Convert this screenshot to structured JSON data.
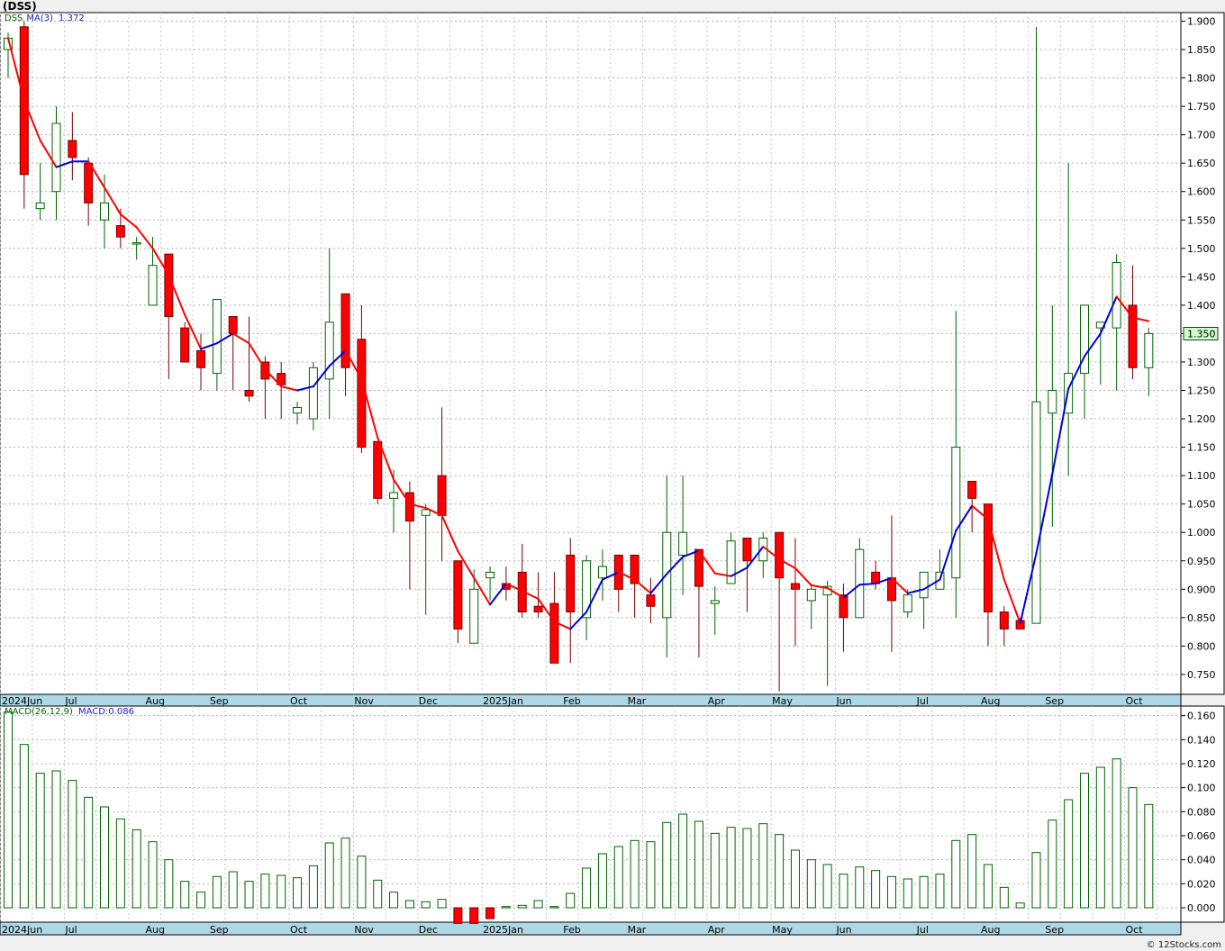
{
  "title": "(DSS)",
  "price_legend": {
    "symbol": "DSS",
    "ma_label": "MA(3)",
    "ma_value": "1.372"
  },
  "macd_legend": {
    "label": "MACD(26,12,9)",
    "value": "MACD:0.086"
  },
  "last_price_tag": "1.350",
  "credit": "© 12Stocks.com",
  "colors": {
    "up": "#006400",
    "down": "#ff0000",
    "ma_up": "#0000dd",
    "ma_down": "#ff0000",
    "macd": "#006400",
    "macd_neg": "#ff0000",
    "tag_bg": "#ccffcc"
  },
  "chart_data": [
    {
      "type": "candlestick",
      "title": "(DSS)",
      "ylim": [
        0.715,
        1.915
      ],
      "y_ticks": [
        "1.900",
        "1.850",
        "1.800",
        "1.750",
        "1.700",
        "1.650",
        "1.600",
        "1.550",
        "1.500",
        "1.450",
        "1.400",
        "1.350",
        "1.300",
        "1.250",
        "1.200",
        "1.150",
        "1.100",
        "1.050",
        "1.000",
        "0.950",
        "0.900",
        "0.850",
        "0.800",
        "0.750"
      ],
      "x_labels": [
        "2024Jun",
        "Jul",
        "Aug",
        "Sep",
        "Oct",
        "Nov",
        "Dec",
        "2025Jan",
        "Feb",
        "Mar",
        "Apr",
        "May",
        "Jun",
        "Jul",
        "Aug",
        "Sep",
        "Oct"
      ],
      "x_label_weeks": [
        0,
        4,
        9,
        13,
        18,
        22,
        26,
        30,
        35,
        39,
        44,
        48,
        52,
        57,
        61,
        65,
        70
      ],
      "weeks": 73,
      "ohlc": [
        [
          1.85,
          1.88,
          1.8,
          1.87
        ],
        [
          1.89,
          1.9,
          1.57,
          1.63
        ],
        [
          1.57,
          1.65,
          1.55,
          1.58
        ],
        [
          1.6,
          1.75,
          1.55,
          1.72
        ],
        [
          1.69,
          1.74,
          1.62,
          1.66
        ],
        [
          1.65,
          1.66,
          1.54,
          1.58
        ],
        [
          1.55,
          1.63,
          1.5,
          1.58
        ],
        [
          1.54,
          1.57,
          1.5,
          1.52
        ],
        [
          1.51,
          1.52,
          1.48,
          1.51
        ],
        [
          1.4,
          1.52,
          1.4,
          1.47
        ],
        [
          1.49,
          1.49,
          1.27,
          1.38
        ],
        [
          1.36,
          1.37,
          1.3,
          1.3
        ],
        [
          1.32,
          1.35,
          1.25,
          1.29
        ],
        [
          1.28,
          1.41,
          1.25,
          1.41
        ],
        [
          1.38,
          1.38,
          1.25,
          1.35
        ],
        [
          1.25,
          1.38,
          1.23,
          1.24
        ],
        [
          1.3,
          1.31,
          1.2,
          1.27
        ],
        [
          1.28,
          1.3,
          1.2,
          1.26
        ],
        [
          1.21,
          1.23,
          1.19,
          1.22
        ],
        [
          1.2,
          1.3,
          1.18,
          1.29
        ],
        [
          1.27,
          1.5,
          1.2,
          1.37
        ],
        [
          1.42,
          1.42,
          1.24,
          1.29
        ],
        [
          1.34,
          1.4,
          1.14,
          1.15
        ],
        [
          1.16,
          1.16,
          1.05,
          1.06
        ],
        [
          1.06,
          1.11,
          1.0,
          1.07
        ],
        [
          1.07,
          1.09,
          0.9,
          1.02
        ],
        [
          1.03,
          1.05,
          0.855,
          1.04
        ],
        [
          1.1,
          1.22,
          0.95,
          1.03
        ],
        [
          0.95,
          0.95,
          0.805,
          0.83
        ],
        [
          0.805,
          0.935,
          0.805,
          0.9
        ],
        [
          0.92,
          0.94,
          0.88,
          0.93
        ],
        [
          0.91,
          0.94,
          0.88,
          0.9
        ],
        [
          0.93,
          0.98,
          0.85,
          0.86
        ],
        [
          0.87,
          0.93,
          0.85,
          0.86
        ],
        [
          0.875,
          0.93,
          0.77,
          0.77
        ],
        [
          0.96,
          0.99,
          0.77,
          0.86
        ],
        [
          0.85,
          0.96,
          0.81,
          0.95
        ],
        [
          0.92,
          0.97,
          0.88,
          0.94
        ],
        [
          0.96,
          0.96,
          0.86,
          0.9
        ],
        [
          0.96,
          0.96,
          0.85,
          0.91
        ],
        [
          0.89,
          0.92,
          0.84,
          0.87
        ],
        [
          0.85,
          1.1,
          0.78,
          1.0
        ],
        [
          0.96,
          1.1,
          0.89,
          1.0
        ],
        [
          0.97,
          0.97,
          0.78,
          0.905
        ],
        [
          0.875,
          0.905,
          0.82,
          0.88
        ],
        [
          0.91,
          1.0,
          0.91,
          0.985
        ],
        [
          0.99,
          0.99,
          0.86,
          0.95
        ],
        [
          0.95,
          1.0,
          0.92,
          0.99
        ],
        [
          1.0,
          1.0,
          0.72,
          0.92
        ],
        [
          0.91,
          0.99,
          0.8,
          0.9
        ],
        [
          0.88,
          0.91,
          0.83,
          0.9
        ],
        [
          0.89,
          0.915,
          0.73,
          0.905
        ],
        [
          0.89,
          0.91,
          0.79,
          0.85
        ],
        [
          0.85,
          0.99,
          0.85,
          0.97
        ],
        [
          0.93,
          0.95,
          0.9,
          0.91
        ],
        [
          0.92,
          1.03,
          0.79,
          0.88
        ],
        [
          0.86,
          0.9,
          0.85,
          0.89
        ],
        [
          0.885,
          0.93,
          0.83,
          0.93
        ],
        [
          0.9,
          0.97,
          0.9,
          0.93
        ],
        [
          0.92,
          1.39,
          0.85,
          1.15
        ],
        [
          1.09,
          1.09,
          1.0,
          1.06
        ],
        [
          1.05,
          1.05,
          0.8,
          0.86
        ],
        [
          0.86,
          0.87,
          0.8,
          0.83
        ],
        [
          0.845,
          0.85,
          0.83,
          0.83
        ],
        [
          0.84,
          1.89,
          0.84,
          1.23
        ],
        [
          1.21,
          1.4,
          1.01,
          1.25
        ],
        [
          1.21,
          1.65,
          1.1,
          1.28
        ],
        [
          1.28,
          1.4,
          1.2,
          1.4
        ],
        [
          1.36,
          1.37,
          1.26,
          1.37
        ],
        [
          1.36,
          1.49,
          1.25,
          1.475
        ],
        [
          1.4,
          1.47,
          1.27,
          1.29
        ],
        [
          1.29,
          1.36,
          1.24,
          1.35
        ]
      ],
      "ma3": [
        1.87,
        1.76,
        1.69,
        1.643,
        1.653,
        1.653,
        1.607,
        1.56,
        1.537,
        1.5,
        1.453,
        1.383,
        1.323,
        1.333,
        1.35,
        1.333,
        1.287,
        1.257,
        1.25,
        1.257,
        1.293,
        1.32,
        1.27,
        1.167,
        1.093,
        1.05,
        1.043,
        1.03,
        0.967,
        0.92,
        0.873,
        0.91,
        0.897,
        0.883,
        0.843,
        0.83,
        0.86,
        0.917,
        0.93,
        0.917,
        0.893,
        0.927,
        0.957,
        0.968,
        0.928,
        0.923,
        0.938,
        0.975,
        0.953,
        0.937,
        0.907,
        0.902,
        0.885,
        0.908,
        0.91,
        0.92,
        0.893,
        0.9,
        0.917,
        1.003,
        1.047,
        1.023,
        0.917,
        0.84,
        0.963,
        1.103,
        1.253,
        1.31,
        1.35,
        1.415,
        1.378,
        1.372
      ]
    },
    {
      "type": "bar",
      "title": "MACD(26,12,9)",
      "ylim": [
        -0.012,
        0.168
      ],
      "y_ticks": [
        "0.160",
        "0.140",
        "0.120",
        "0.100",
        "0.080",
        "0.060",
        "0.040",
        "0.020",
        "0.000"
      ],
      "values": [
        0.163,
        0.136,
        0.112,
        0.114,
        0.106,
        0.092,
        0.084,
        0.074,
        0.065,
        0.055,
        0.04,
        0.022,
        0.013,
        0.026,
        0.03,
        0.022,
        0.028,
        0.027,
        0.025,
        0.035,
        0.054,
        0.058,
        0.043,
        0.023,
        0.013,
        0.006,
        0.005,
        0.007,
        -0.013,
        -0.013,
        -0.009,
        0.001,
        0.002,
        0.006,
        0.001,
        0.012,
        0.033,
        0.045,
        0.051,
        0.056,
        0.055,
        0.071,
        0.078,
        0.072,
        0.062,
        0.067,
        0.066,
        0.07,
        0.061,
        0.048,
        0.04,
        0.036,
        0.028,
        0.034,
        0.031,
        0.026,
        0.024,
        0.026,
        0.028,
        0.056,
        0.061,
        0.036,
        0.017,
        0.004,
        0.046,
        0.073,
        0.09,
        0.112,
        0.117,
        0.124,
        0.1,
        0.086
      ]
    }
  ]
}
